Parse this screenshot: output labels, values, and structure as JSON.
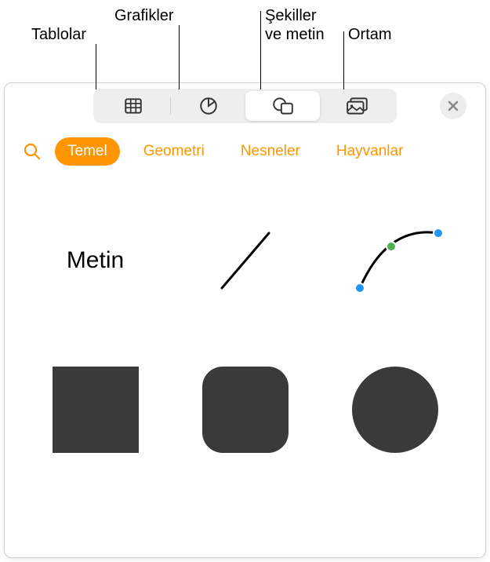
{
  "callouts": {
    "tables": "Tablolar",
    "charts": "Grafikler",
    "shapes_text_line1": "Şekiller",
    "shapes_text_line2": "ve metin",
    "media": "Ortam"
  },
  "toolbar": {
    "tables_name": "tables-button",
    "charts_name": "charts-button",
    "shapes_name": "shapes-button",
    "media_name": "media-button"
  },
  "tabs": {
    "basic": "Temel",
    "geometry": "Geometri",
    "objects": "Nesneler",
    "animals": "Hayvanlar"
  },
  "shapes": {
    "text_label": "Metin"
  },
  "colors": {
    "accent": "#ff9500",
    "shape_fill": "#3a3a3a",
    "point_blue": "#2196f3",
    "point_green": "#4caf50"
  }
}
